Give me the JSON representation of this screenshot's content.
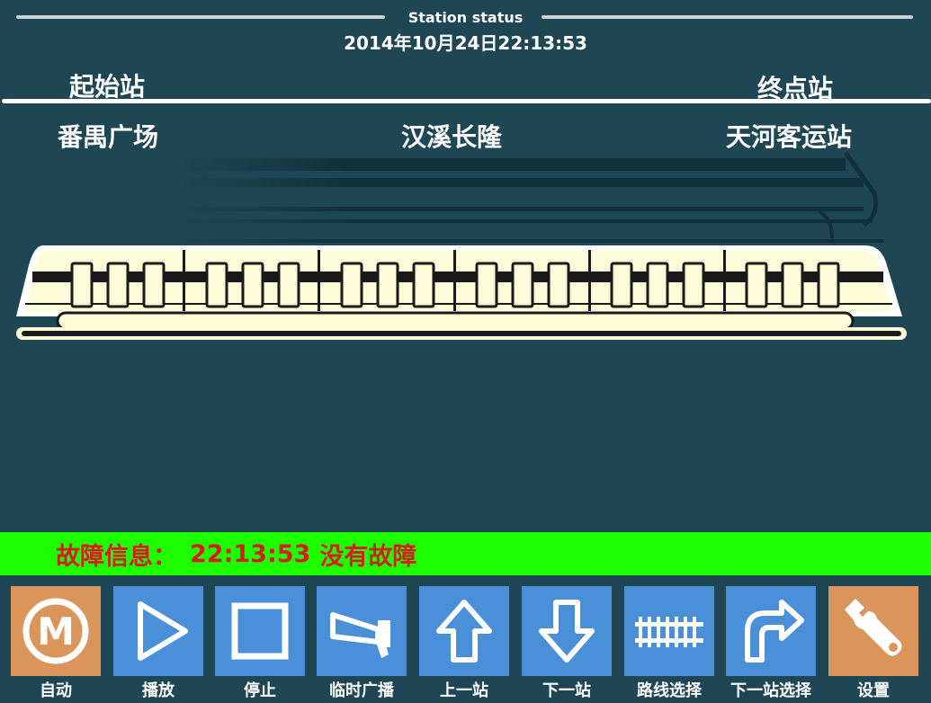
{
  "header": {
    "title": "Station status",
    "datetime": "2014年10月24日22:13:53"
  },
  "route": {
    "start_label": "起始站",
    "end_label": "终点站",
    "start_station": "番禺广场",
    "current_station": "汉溪长隆",
    "end_station": "天河客运站"
  },
  "fault": {
    "label": "故障信息：",
    "time": "22:13:53",
    "message": "没有故障"
  },
  "colors": {
    "background": "#1f4654",
    "fault_bar": "#1dff00",
    "fault_text": "#d61c1c",
    "button_blue": "#4a90d9",
    "button_orange": "#d9955a",
    "train_body": "#fefbd8"
  },
  "toolbar": {
    "buttons": [
      {
        "label": "自动",
        "icon": "metro-logo-icon",
        "color": "#d9955a"
      },
      {
        "label": "播放",
        "icon": "play-icon",
        "color": "#4a90d9"
      },
      {
        "label": "停止",
        "icon": "stop-icon",
        "color": "#4a90d9"
      },
      {
        "label": "临时广播",
        "icon": "megaphone-icon",
        "color": "#4a90d9"
      },
      {
        "label": "上一站",
        "icon": "arrow-up-icon",
        "color": "#4a90d9"
      },
      {
        "label": "下一站",
        "icon": "arrow-down-icon",
        "color": "#4a90d9"
      },
      {
        "label": "路线选择",
        "icon": "railway-track-icon",
        "color": "#4a90d9"
      },
      {
        "label": "下一站选择",
        "icon": "turn-right-arrow-icon",
        "color": "#4a90d9"
      },
      {
        "label": "设置",
        "icon": "wrench-icon",
        "color": "#d9955a"
      }
    ]
  }
}
